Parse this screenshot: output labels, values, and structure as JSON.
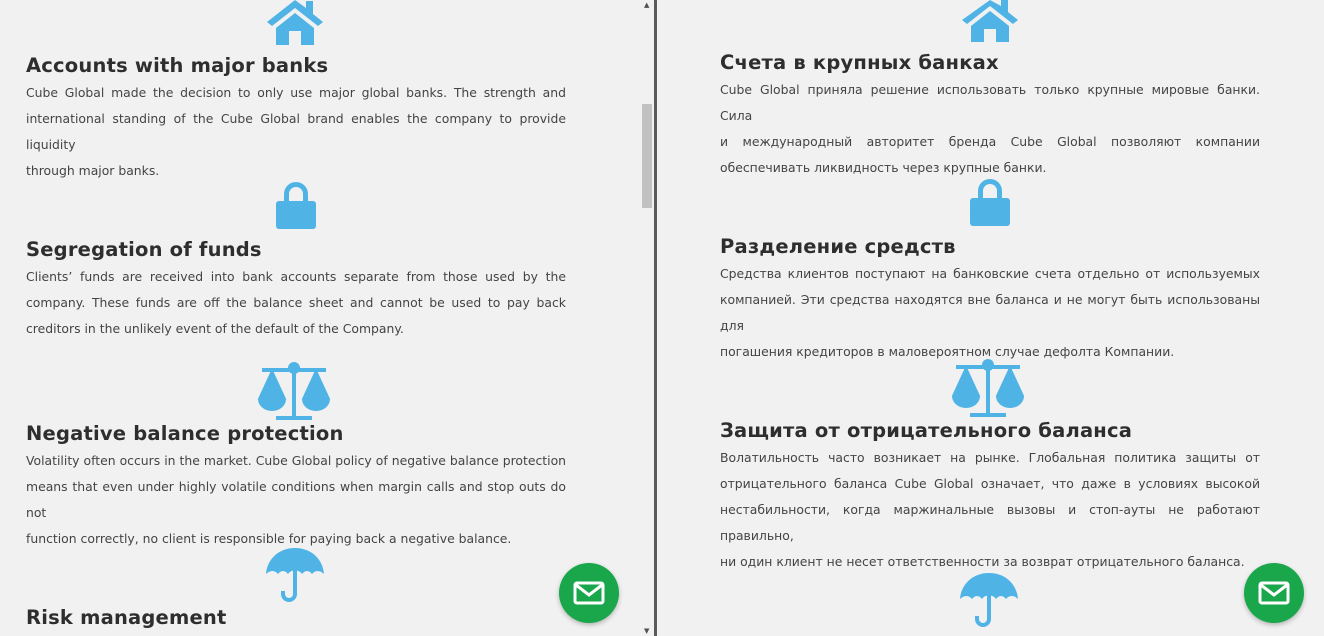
{
  "colors": {
    "icon": "#4fb3e6",
    "mail_button": "#1aa64a",
    "background": "#f1f1f2"
  },
  "en": {
    "features": [
      {
        "icon": "house-icon",
        "title": "Accounts with major banks",
        "lines": [
          "Cube Global made the decision to only use major global banks. The strength and",
          "international standing of the Cube Global brand enables the company to provide liquidity",
          "through major banks."
        ]
      },
      {
        "icon": "lock-icon",
        "title": "Segregation of funds",
        "lines": [
          "Clients’ funds are received into bank accounts separate from those used by the",
          "company. These funds are off the balance sheet and cannot be used to pay back",
          "creditors in the unlikely event of the default of the Company."
        ]
      },
      {
        "icon": "scales-icon",
        "title": "Negative balance protection",
        "lines": [
          "Volatility often occurs in the market. Cube Global policy of negative balance protection",
          "means that even under highly volatile conditions when margin calls and stop outs do not",
          "function correctly, no client is responsible for paying back a negative balance."
        ]
      },
      {
        "icon": "umbrella-icon",
        "title": "Risk management",
        "lines": []
      }
    ]
  },
  "ru": {
    "features": [
      {
        "icon": "house-icon",
        "title": "Счета в крупных банках",
        "lines": [
          "Cube Global приняла решение использовать только крупные мировые банки. Сила",
          "и международный авторитет бренда Cube Global позволяют компании",
          "обеспечивать ликвидность через крупные банки."
        ]
      },
      {
        "icon": "lock-icon",
        "title": "Разделение средств",
        "lines": [
          "Средства клиентов поступают на банковские счета отдельно от используемых",
          "компанией. Эти средства находятся вне баланса и не могут быть использованы для",
          "погашения кредиторов в маловероятном случае дефолта Компании."
        ]
      },
      {
        "icon": "scales-icon",
        "title": "Защита от отрицательного баланса",
        "lines": [
          "Волатильность часто возникает на рынке. Глобальная политика защиты от",
          "отрицательного баланса Cube Global означает, что даже в условиях высокой",
          "нестабильности, когда маржинальные вызовы и стоп-ауты не работают правильно,",
          "ни один клиент не несет ответственности за возврат отрицательного баланса."
        ]
      },
      {
        "icon": "umbrella-icon",
        "title": "",
        "lines": []
      }
    ]
  }
}
